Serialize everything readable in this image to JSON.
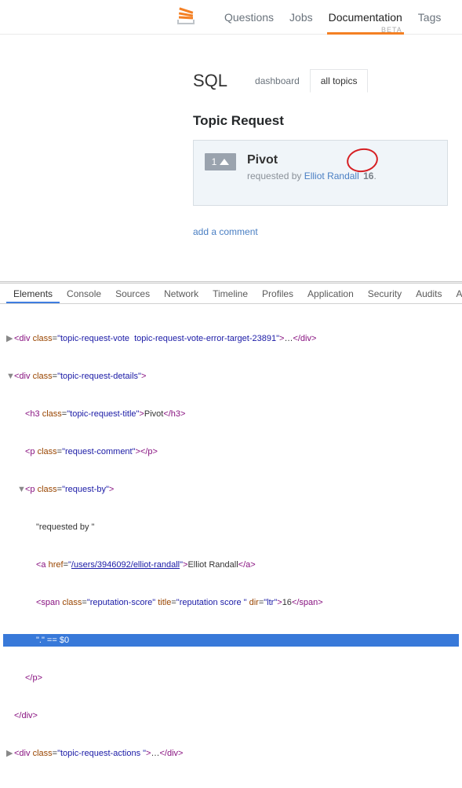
{
  "topnav": {
    "items": [
      "Questions",
      "Jobs",
      "Documentation",
      "Tags"
    ],
    "beta": "BETA"
  },
  "subhead": {
    "title": "SQL",
    "tabs": [
      "dashboard",
      "all topics"
    ]
  },
  "section": {
    "title": "Topic Request"
  },
  "topic": {
    "vote_count": "1",
    "title": "Pivot",
    "by_prefix": "requested by ",
    "user": "Elliot Randall",
    "rep": "16",
    "dot": "."
  },
  "comment_link": "add a comment",
  "devtools": {
    "tabs": [
      "Elements",
      "Console",
      "Sources",
      "Network",
      "Timeline",
      "Profiles",
      "Application",
      "Security",
      "Audits",
      "A"
    ]
  },
  "dom": {
    "l0": {
      "cls": "topic-request-vote  topic-request-vote-error-target-23891",
      "tail": "…"
    },
    "l1": {
      "cls": "topic-request-details"
    },
    "l2": {
      "tag": "h3",
      "cls": "topic-request-title",
      "text": "Pivot"
    },
    "l3": {
      "tag": "p",
      "cls": "request-comment"
    },
    "l4": {
      "tag": "p",
      "cls": "request-by"
    },
    "l5": {
      "text": "\"requested by \""
    },
    "l6": {
      "href": "/users/3946092/elliot-randall",
      "text": "Elliot Randall"
    },
    "l7": {
      "cls": "reputation-score",
      "title": "reputation score ",
      "dir": "ltr",
      "text": "16"
    },
    "l8": {
      "text": "\".\"",
      "eq": " == ",
      "sel": "$0"
    },
    "l9": {
      "close": "p"
    },
    "l10": {
      "close": "div"
    },
    "l11": {
      "cls": "topic-request-actions ",
      "tail": "…"
    }
  }
}
